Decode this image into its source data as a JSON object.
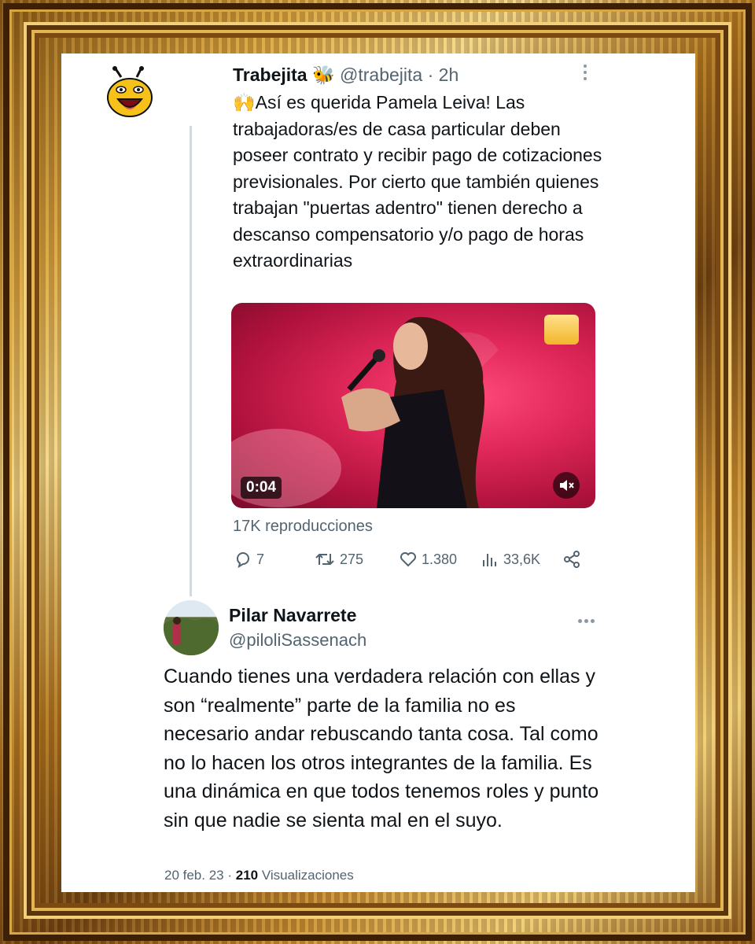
{
  "tweet1": {
    "name": "Trabejita",
    "name_emoji": "🐝",
    "handle": "@trabejita",
    "separator": "·",
    "time": "2h",
    "text": "🙌Así es querida Pamela Leiva! Las trabajadoras/es de casa particular deben poseer contrato y recibir pago de cotizaciones previsionales. Por cierto que también quienes trabajan \"puertas adentro\" tienen derecho a descanso compensatorio y/o pago de horas extraordinarias",
    "video_time": "0:04",
    "views": "17K reproducciones",
    "replies": "7",
    "retweets": "275",
    "likes": "1.380",
    "analytics": "33,6K"
  },
  "tweet2": {
    "name": "Pilar Navarrete",
    "handle": "@piloliSassenach",
    "text": "Cuando tienes una verdadera relación con ellas y son “realmente” parte de la familia no es necesario andar rebuscando tanta cosa. Tal como no lo hacen los otros integrantes de la familia. Es una dinámica en que todos tenemos roles y punto sin que nadie se sienta mal en el suyo.",
    "date": "20 feb. 23",
    "separator": "·",
    "views_count": "210",
    "views_label": "Visualizaciones"
  },
  "colors": {
    "text_primary": "#0f1419",
    "text_secondary": "#536471",
    "thread_line": "#cfd9de",
    "frame_gold": "#d9a640"
  },
  "icons": [
    "reply-icon",
    "retweet-icon",
    "like-icon",
    "analytics-icon",
    "share-icon",
    "mute-icon",
    "more-icon"
  ]
}
